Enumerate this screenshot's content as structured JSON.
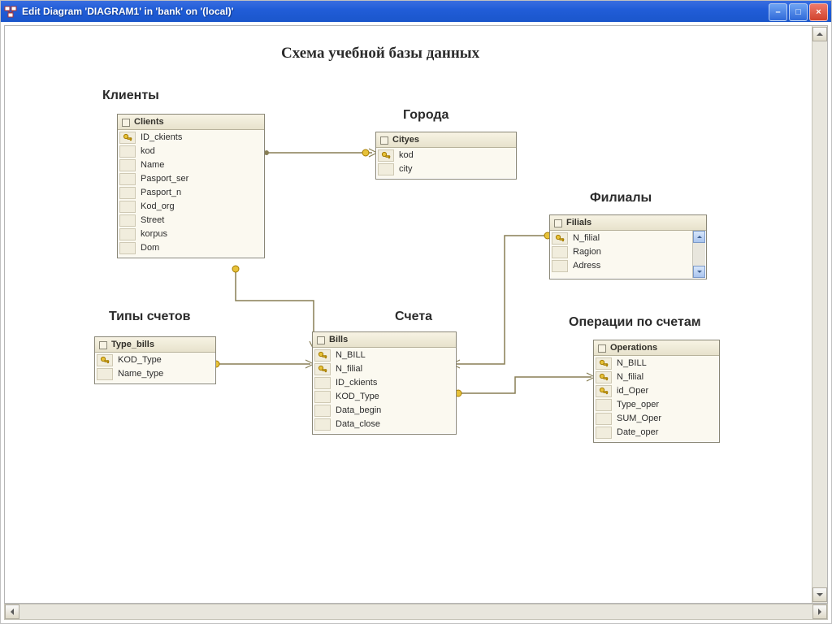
{
  "window": {
    "title": "Edit Diagram 'DIAGRAM1' in 'bank' on '(local)'"
  },
  "diagram": {
    "title": "Схема учебной базы данных"
  },
  "sections": {
    "clients": "Клиенты",
    "cities": "Города",
    "branches": "Филиалы",
    "billTypes": "Типы счетов",
    "bills": "Счета",
    "operations": "Операции по счетам"
  },
  "tables": {
    "clients": {
      "name": "Clients",
      "cols": [
        {
          "pk": true,
          "name": "ID_ckients"
        },
        {
          "pk": false,
          "name": "kod"
        },
        {
          "pk": false,
          "name": "Name"
        },
        {
          "pk": false,
          "name": "Pasport_ser"
        },
        {
          "pk": false,
          "name": "Pasport_n"
        },
        {
          "pk": false,
          "name": "Kod_org"
        },
        {
          "pk": false,
          "name": "Street"
        },
        {
          "pk": false,
          "name": "korpus"
        },
        {
          "pk": false,
          "name": "Dom"
        }
      ]
    },
    "cityes": {
      "name": "Cityes",
      "cols": [
        {
          "pk": true,
          "name": "kod"
        },
        {
          "pk": false,
          "name": "city"
        }
      ]
    },
    "filials": {
      "name": "Filials",
      "cols": [
        {
          "pk": true,
          "name": "N_filial"
        },
        {
          "pk": false,
          "name": "Ragion"
        },
        {
          "pk": false,
          "name": "Adress"
        }
      ]
    },
    "typeBills": {
      "name": "Type_bills",
      "cols": [
        {
          "pk": true,
          "name": "KOD_Type"
        },
        {
          "pk": false,
          "name": "Name_type"
        }
      ]
    },
    "bills": {
      "name": "Bills",
      "cols": [
        {
          "pk": true,
          "name": "N_BILL"
        },
        {
          "pk": true,
          "name": "N_filial"
        },
        {
          "pk": false,
          "name": "ID_ckients"
        },
        {
          "pk": false,
          "name": "KOD_Type"
        },
        {
          "pk": false,
          "name": "Data_begin"
        },
        {
          "pk": false,
          "name": "Data_close"
        }
      ]
    },
    "operations": {
      "name": "Operations",
      "cols": [
        {
          "pk": true,
          "name": "N_BILL"
        },
        {
          "pk": true,
          "name": "N_filial"
        },
        {
          "pk": true,
          "name": "id_Oper"
        },
        {
          "pk": false,
          "name": "Type_oper"
        },
        {
          "pk": false,
          "name": "SUM_Oper"
        },
        {
          "pk": false,
          "name": "Date_oper"
        }
      ]
    }
  },
  "icons": {
    "key": "primary-key-icon",
    "app": "diagram-app-icon"
  }
}
